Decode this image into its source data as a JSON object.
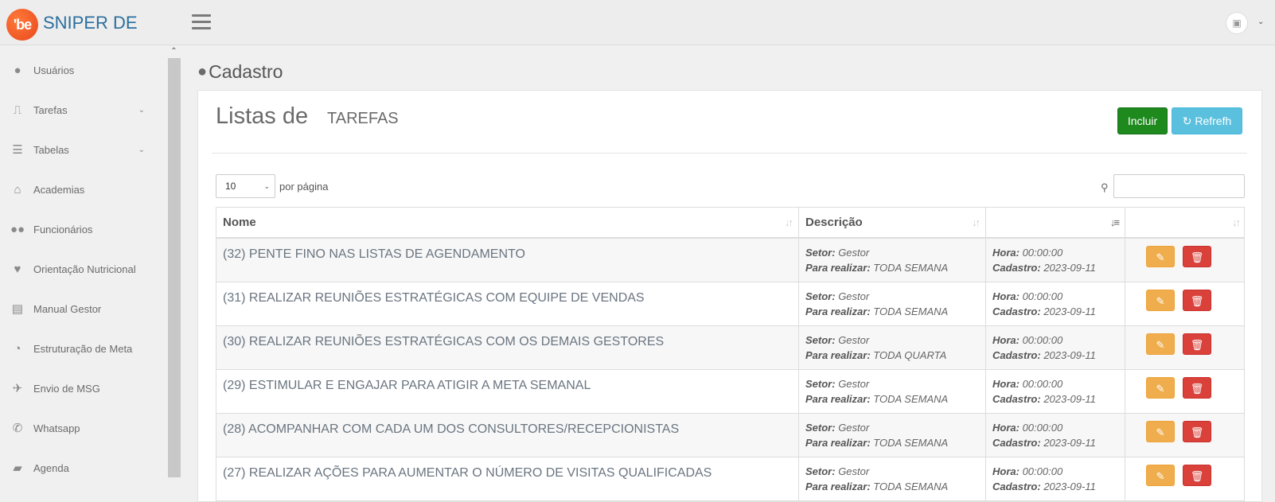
{
  "header": {
    "logo_text": "'be",
    "brand": "SNIPER DE"
  },
  "sidebar": {
    "items": [
      {
        "label": "Usuários",
        "icon": "user-icon",
        "glyph": "●",
        "has_submenu": false
      },
      {
        "label": "Tarefas",
        "icon": "bookmark-icon",
        "glyph": "⎍",
        "has_submenu": true
      },
      {
        "label": "Tabelas",
        "icon": "table-icon",
        "glyph": "☰",
        "has_submenu": true
      },
      {
        "label": "Academias",
        "icon": "home-icon",
        "glyph": "⌂",
        "has_submenu": false
      },
      {
        "label": "Funcionários",
        "icon": "users-icon",
        "glyph": "●●",
        "has_submenu": false
      },
      {
        "label": "Orientação Nutricional",
        "icon": "heartbeat-icon",
        "glyph": "♥",
        "has_submenu": false
      },
      {
        "label": "Manual Gestor",
        "icon": "copy-icon",
        "glyph": "▤",
        "has_submenu": false
      },
      {
        "label": "Estruturação de Meta",
        "icon": "pie-chart-icon",
        "glyph": "◔",
        "has_submenu": false
      },
      {
        "label": "Envio de MSG",
        "icon": "plane-icon",
        "glyph": "✈",
        "has_submenu": false
      },
      {
        "label": "Whatsapp",
        "icon": "whatsapp-icon",
        "glyph": "✆",
        "has_submenu": false
      },
      {
        "label": "Agenda",
        "icon": "book-icon",
        "glyph": "▰",
        "has_submenu": false
      }
    ]
  },
  "page": {
    "title": "Cadastro",
    "list_title": "Listas de",
    "list_subtitle": "TAREFAS",
    "incluir_label": "Incluir",
    "refresh_label": "Refrefh",
    "per_page_value": "10",
    "per_page_label": "por página"
  },
  "table": {
    "columns": [
      "Nome",
      "Descrição",
      "",
      ""
    ],
    "setor_label": "Setor:",
    "realizar_label": "Para realizar:",
    "hora_label": "Hora:",
    "cadastro_label": "Cadastro:",
    "rows": [
      {
        "nome": "(32) PENTE FINO NAS LISTAS DE AGENDAMENTO",
        "setor": "Gestor",
        "realizar": "TODA SEMANA",
        "hora": "00:00:00",
        "cadastro": "2023-09-11"
      },
      {
        "nome": "(31) REALIZAR REUNIÕES ESTRATÉGICAS COM EQUIPE DE VENDAS",
        "setor": "Gestor",
        "realizar": "TODA SEMANA",
        "hora": "00:00:00",
        "cadastro": "2023-09-11"
      },
      {
        "nome": "(30) REALIZAR REUNIÕES ESTRATÉGICAS COM OS DEMAIS GESTORES",
        "setor": "Gestor",
        "realizar": "TODA QUARTA",
        "hora": "00:00:00",
        "cadastro": "2023-09-11"
      },
      {
        "nome": "(29) ESTIMULAR E ENGAJAR PARA ATIGIR A META SEMANAL",
        "setor": "Gestor",
        "realizar": "TODA SEMANA",
        "hora": "00:00:00",
        "cadastro": "2023-09-11"
      },
      {
        "nome": "(28) ACOMPANHAR COM CADA UM DOS CONSULTORES/RECEPCIONISTAS",
        "setor": "Gestor",
        "realizar": "TODA SEMANA",
        "hora": "00:00:00",
        "cadastro": "2023-09-11"
      },
      {
        "nome": "(27) REALIZAR AÇÕES PARA AUMENTAR O NÚMERO DE VISITAS QUALIFICADAS",
        "setor": "Gestor",
        "realizar": "TODA SEMANA",
        "hora": "00:00:00",
        "cadastro": "2023-09-11"
      }
    ]
  },
  "colors": {
    "brand": "#2a6f9e",
    "incluir": "#1e8a1e",
    "refresh": "#5bc0de",
    "edit": "#f0ad4e",
    "delete": "#d9413a"
  }
}
